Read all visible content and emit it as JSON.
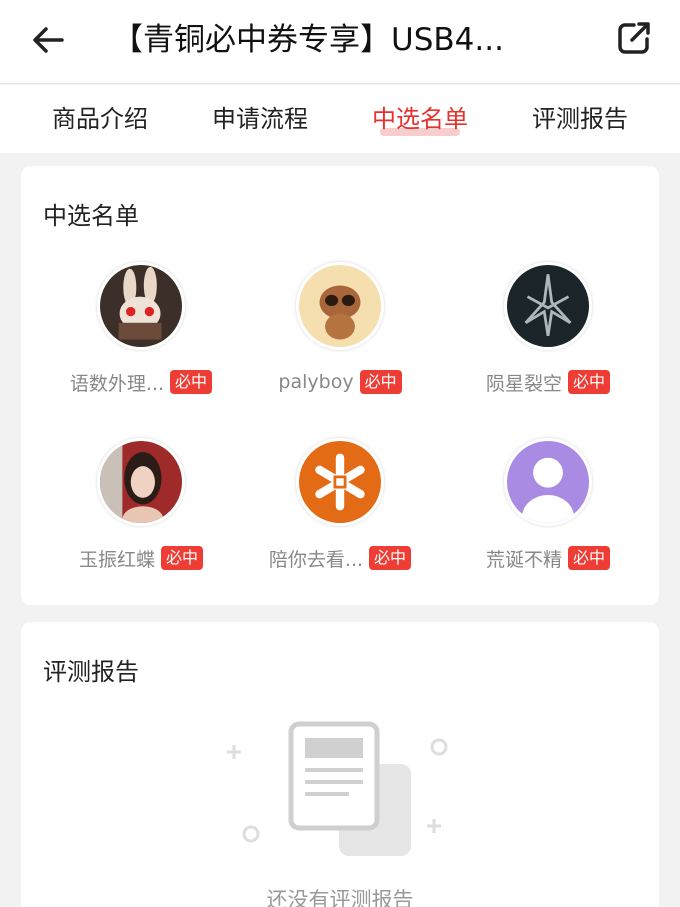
{
  "header": {
    "title": "【青铜必中券专享】USB4...",
    "back_icon": "arrow-left-icon",
    "share_icon": "share-icon"
  },
  "tabs": [
    {
      "label": "商品介绍",
      "active": false
    },
    {
      "label": "申请流程",
      "active": false
    },
    {
      "label": "中选名单",
      "active": true
    },
    {
      "label": "评测报告",
      "active": false
    }
  ],
  "winners": {
    "title": "中选名单",
    "badge": "必中",
    "items": [
      {
        "name": "语数外理...",
        "avatar": "rabbit-avatar"
      },
      {
        "name": "palyboy",
        "avatar": "creature-avatar"
      },
      {
        "name": "陨星裂空",
        "avatar": "emblem-avatar"
      },
      {
        "name": "玉振红蝶",
        "avatar": "portrait-avatar"
      },
      {
        "name": "陪你去看...",
        "avatar": "flower-logo-avatar"
      },
      {
        "name": "荒诞不精",
        "avatar": "default-user-avatar"
      }
    ]
  },
  "reviews": {
    "title": "评测报告",
    "empty_text": "还没有评测报告",
    "empty_icon": "document-icon"
  },
  "colors": {
    "accent": "#e8302e",
    "badge": "#ee3d35",
    "background": "#f2f2f2"
  }
}
